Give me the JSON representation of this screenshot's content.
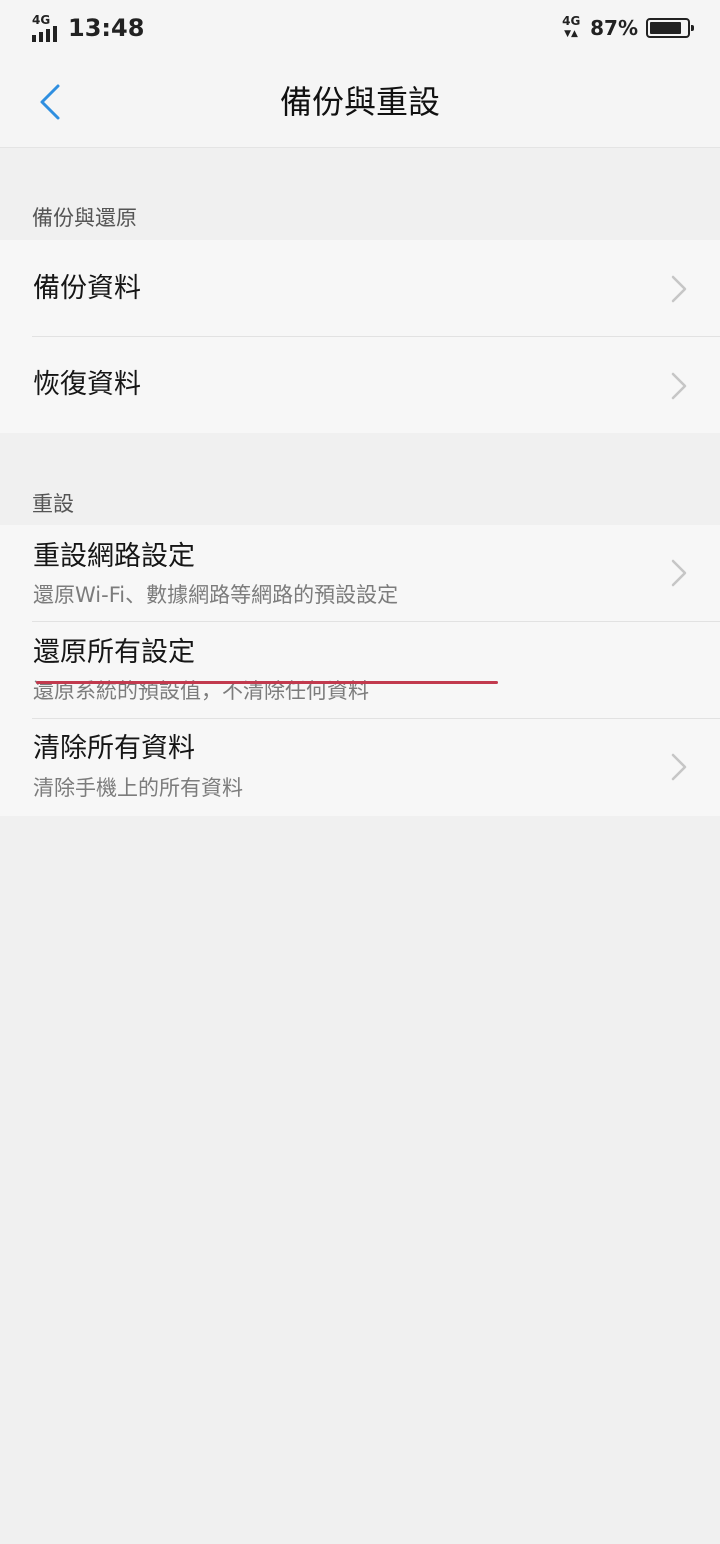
{
  "status_bar": {
    "network_left": "4G",
    "time": "13:48",
    "network_right": "4G",
    "battery_percent": "87%"
  },
  "header": {
    "back_icon": "chevron-left-icon",
    "title": "備份與重設"
  },
  "sections": {
    "backup": {
      "label": "備份與還原",
      "items": [
        {
          "title": "備份資料"
        },
        {
          "title": "恢復資料"
        }
      ]
    },
    "reset": {
      "label": "重設",
      "items": [
        {
          "title": "重設網路設定",
          "subtitle": "還原Wi-Fi、數據網路等網路的預設設定"
        },
        {
          "title": "還原所有設定",
          "subtitle": "還原系統的預設值，不清除任何資料"
        },
        {
          "title": "清除所有資料",
          "subtitle": "清除手機上的所有資料"
        }
      ]
    }
  },
  "colors": {
    "accent": "#2f8fe0",
    "annotation": "#c23a4e",
    "chevron": "#c6c6c6"
  }
}
